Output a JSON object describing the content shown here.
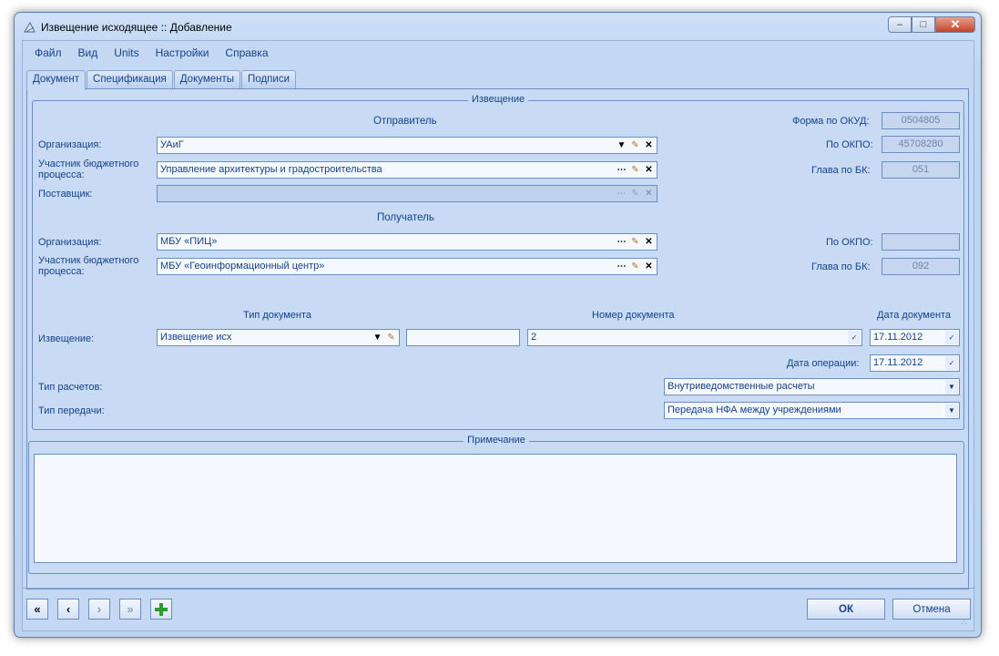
{
  "window": {
    "title": "Извещение исходящее :: Добавление"
  },
  "menu": [
    "Файл",
    "Вид",
    "Units",
    "Настройки",
    "Справка"
  ],
  "tabs": [
    "Документ",
    "Спецификация",
    "Документы",
    "Подписи"
  ],
  "notice_group": {
    "title": "Извещение",
    "sender_title": "Отправитель",
    "recipient_title": "Получатель",
    "org_label": "Организация:",
    "participant_label": "Участник бюджетного процесса:",
    "supplier_label": "Поставщик:",
    "sender_org": "УАиГ",
    "sender_participant": "Управление архитектуры и градостроительства",
    "supplier": "",
    "recipient_org": "МБУ «ПИЦ»",
    "recipient_participant": "МБУ «Геоинформационный центр»",
    "okud_label": "Форма по ОКУД:",
    "okud_value": "0504805",
    "okpo_label": "По ОКПО:",
    "sender_okpo": "45708280",
    "recipient_okpo": "",
    "bk_label": "Глава по БК:",
    "sender_bk": "051",
    "recipient_bk": "092",
    "doc_type_header": "Тип документа",
    "doc_number_header": "Номер документа",
    "doc_date_header": "Дата документа",
    "notice_label": "Извещение:",
    "doc_type_value": "Извещение исх",
    "doc_extra_value": "",
    "doc_number_value": "2",
    "doc_date_value": "17.11.2012",
    "op_date_label": "Дата операции:",
    "op_date_value": "17.11.2012",
    "calc_type_label": "Тип расчетов:",
    "calc_type_value": "Внутриведомственные расчеты",
    "transfer_type_label": "Тип передачи:",
    "transfer_type_value": "Передача НФА между учреждениями"
  },
  "note_group": {
    "title": "Примечание",
    "text": ""
  },
  "buttons": {
    "ok": "ОК",
    "cancel": "Отмена"
  },
  "icons": {
    "first": "first-page-icon",
    "prev": "previous-icon",
    "next": "next-icon",
    "last": "last-page-icon",
    "add": "add-icon",
    "ellipsis": "ellipsis-icon",
    "pick": "pick-icon",
    "clear": "clear-icon"
  }
}
